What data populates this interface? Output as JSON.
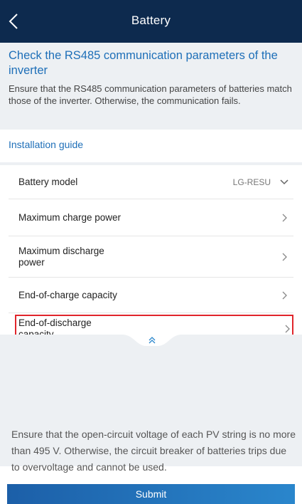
{
  "header": {
    "title": "Battery",
    "back_icon": "chevron-left-icon"
  },
  "notice": {
    "title": "Check the RS485 communication parameters of the inverter",
    "text": "Ensure that the RS485 communication parameters of batteries match those of the inverter. Otherwise, the communication fails."
  },
  "guide": {
    "label": "Installation guide"
  },
  "settings": {
    "rows": [
      {
        "label": "Battery model",
        "value": "LG-RESU",
        "icon": "chevron-down-icon"
      },
      {
        "label": "Maximum charge power",
        "icon": "chevron-right-icon"
      },
      {
        "label": "Maximum discharge power",
        "icon": "chevron-right-icon"
      },
      {
        "label": "End-of-charge capacity",
        "icon": "chevron-right-icon"
      },
      {
        "label": "End-of-discharge capacity",
        "icon": "chevron-right-icon"
      }
    ]
  },
  "panel": {
    "collapse_icon": "double-chevron-up-icon",
    "tip": "Ensure that the open-circuit voltage of each PV string is no more than 495 V. Otherwise, the circuit breaker of batteries trips due to overvoltage and cannot be used."
  },
  "footer": {
    "submit_label": "Submit"
  },
  "colors": {
    "header_bg": "#0d2a4e",
    "accent": "#1e6fb8",
    "highlight_border": "#e0252b",
    "panel_bg": "#edf0f3"
  }
}
